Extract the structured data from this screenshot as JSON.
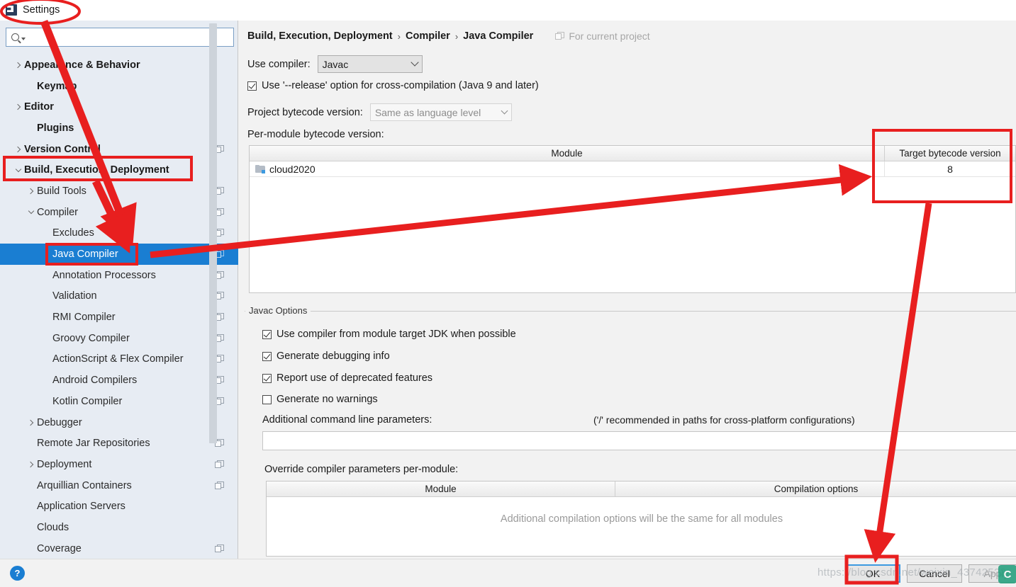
{
  "window": {
    "title": "Settings",
    "icon": "intellij-settings-icon"
  },
  "search": {
    "value": "",
    "placeholder": "",
    "icon": "search-icon"
  },
  "sidebar": {
    "items": [
      {
        "label": "Appearance & Behavior",
        "indent": 0,
        "arrow": "right",
        "bold": true,
        "selected": false,
        "project_icon": false
      },
      {
        "label": "Keymap",
        "indent": 1,
        "arrow": "none",
        "bold": true,
        "selected": false,
        "project_icon": false
      },
      {
        "label": "Editor",
        "indent": 0,
        "arrow": "right",
        "bold": true,
        "selected": false,
        "project_icon": false
      },
      {
        "label": "Plugins",
        "indent": 1,
        "arrow": "none",
        "bold": true,
        "selected": false,
        "project_icon": false
      },
      {
        "label": "Version Control",
        "indent": 0,
        "arrow": "right",
        "bold": true,
        "selected": false,
        "project_icon": true
      },
      {
        "label": "Build, Execution, Deployment",
        "indent": 0,
        "arrow": "down",
        "bold": true,
        "selected": false,
        "project_icon": false
      },
      {
        "label": "Build Tools",
        "indent": 1,
        "arrow": "right",
        "bold": false,
        "selected": false,
        "project_icon": true
      },
      {
        "label": "Compiler",
        "indent": 1,
        "arrow": "down",
        "bold": false,
        "selected": false,
        "project_icon": true
      },
      {
        "label": "Excludes",
        "indent": 2,
        "arrow": "none",
        "bold": false,
        "selected": false,
        "project_icon": true
      },
      {
        "label": "Java Compiler",
        "indent": 2,
        "arrow": "none",
        "bold": false,
        "selected": true,
        "project_icon": true
      },
      {
        "label": "Annotation Processors",
        "indent": 2,
        "arrow": "none",
        "bold": false,
        "selected": false,
        "project_icon": true
      },
      {
        "label": "Validation",
        "indent": 2,
        "arrow": "none",
        "bold": false,
        "selected": false,
        "project_icon": true
      },
      {
        "label": "RMI Compiler",
        "indent": 2,
        "arrow": "none",
        "bold": false,
        "selected": false,
        "project_icon": true
      },
      {
        "label": "Groovy Compiler",
        "indent": 2,
        "arrow": "none",
        "bold": false,
        "selected": false,
        "project_icon": true
      },
      {
        "label": "ActionScript & Flex Compiler",
        "indent": 2,
        "arrow": "none",
        "bold": false,
        "selected": false,
        "project_icon": true
      },
      {
        "label": "Android Compilers",
        "indent": 2,
        "arrow": "none",
        "bold": false,
        "selected": false,
        "project_icon": true
      },
      {
        "label": "Kotlin Compiler",
        "indent": 2,
        "arrow": "none",
        "bold": false,
        "selected": false,
        "project_icon": true
      },
      {
        "label": "Debugger",
        "indent": 1,
        "arrow": "right",
        "bold": false,
        "selected": false,
        "project_icon": false
      },
      {
        "label": "Remote Jar Repositories",
        "indent": 1,
        "arrow": "none",
        "bold": false,
        "selected": false,
        "project_icon": true
      },
      {
        "label": "Deployment",
        "indent": 1,
        "arrow": "right",
        "bold": false,
        "selected": false,
        "project_icon": true
      },
      {
        "label": "Arquillian Containers",
        "indent": 1,
        "arrow": "none",
        "bold": false,
        "selected": false,
        "project_icon": true
      },
      {
        "label": "Application Servers",
        "indent": 1,
        "arrow": "none",
        "bold": false,
        "selected": false,
        "project_icon": false
      },
      {
        "label": "Clouds",
        "indent": 1,
        "arrow": "none",
        "bold": false,
        "selected": false,
        "project_icon": false
      },
      {
        "label": "Coverage",
        "indent": 1,
        "arrow": "none",
        "bold": false,
        "selected": false,
        "project_icon": true
      }
    ]
  },
  "breadcrumb": {
    "part1": "Build, Execution, Deployment",
    "sep": "›",
    "part2": "Compiler",
    "part3": "Java Compiler",
    "scope": "For current project"
  },
  "main": {
    "use_compiler_label": "Use compiler:",
    "use_compiler_value": "Javac",
    "release_option_label": "Use '--release' option for cross-compilation (Java 9 and later)",
    "release_option_checked": true,
    "project_bytecode_label": "Project bytecode version:",
    "project_bytecode_value": "Same as language level",
    "per_module_label": "Per-module bytecode version:",
    "module_table": {
      "columns": [
        "Module",
        "Target bytecode version"
      ],
      "rows": [
        {
          "module": "cloud2020",
          "target": "8"
        }
      ]
    },
    "javac_group_title": "Javac Options",
    "options": [
      {
        "label": "Use compiler from module target JDK when possible",
        "checked": true
      },
      {
        "label": "Generate debugging info",
        "checked": true
      },
      {
        "label": "Report use of deprecated features",
        "checked": true
      },
      {
        "label": "Generate no warnings",
        "checked": false
      }
    ],
    "additional_params_label": "Additional command line parameters:",
    "additional_params_hint": "('/' recommended in paths for cross-platform configurations)",
    "additional_params_value": "",
    "override_label": "Override compiler parameters per-module:",
    "override_table": {
      "columns": [
        "Module",
        "Compilation options"
      ],
      "empty_text": "Additional compilation options will be the same for all modules"
    }
  },
  "footer": {
    "help_label": "?",
    "ok_label": "OK",
    "cancel_label": "Cancel",
    "apply_label": "Apply"
  },
  "watermark": {
    "text": "https://blog.csdn.net/weixin_43742522",
    "logo": "csdn-logo"
  },
  "annotations": {
    "color": "#e81f1f"
  }
}
